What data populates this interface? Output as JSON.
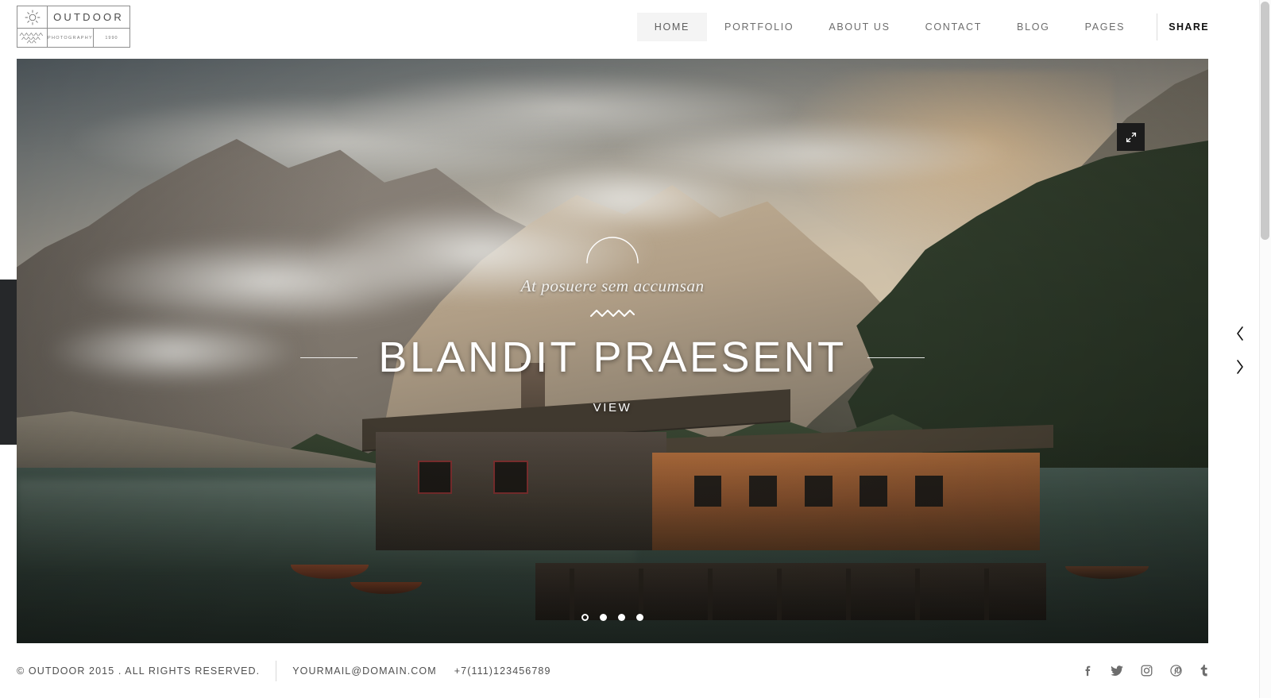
{
  "header": {
    "logo": {
      "name": "OUTDOOR",
      "subtitle": "PHOTOGRAPHY",
      "year": "1990",
      "sun_icon": "sun-icon",
      "mountain_icon": "mountain-pattern-icon"
    },
    "nav": [
      {
        "label": "HOME",
        "active": true
      },
      {
        "label": "PORTFOLIO",
        "active": false
      },
      {
        "label": "ABOUT US",
        "active": false
      },
      {
        "label": "CONTACT",
        "active": false
      },
      {
        "label": "BLOG",
        "active": false
      },
      {
        "label": "PAGES",
        "active": false
      }
    ],
    "share_label": "SHARE"
  },
  "hero": {
    "subtitle": "At posuere sem accumsan",
    "title": "BLANDIT PRAESENT",
    "view_label": "VIEW",
    "expand_icon": "expand-arrows-icon",
    "arc_icon": "arc-ornament-icon",
    "zigzag_icon": "zigzag-divider-icon",
    "dots": [
      {
        "state": "hollow"
      },
      {
        "state": "filled"
      },
      {
        "state": "filled"
      },
      {
        "state": "filled"
      }
    ],
    "prev_icon": "chevron-left-icon",
    "next_icon": "chevron-right-icon",
    "left_tab": "sidebar-toggle-tab"
  },
  "footer": {
    "copyright": "© OUTDOOR 2015 . ALL RIGHTS RESERVED.",
    "email": "YOURMAIL@DOMAIN.COM",
    "phone": "+7(111)123456789",
    "socials": [
      {
        "name": "facebook-icon"
      },
      {
        "name": "twitter-icon"
      },
      {
        "name": "instagram-icon"
      },
      {
        "name": "pinterest-icon"
      },
      {
        "name": "tumblr-icon"
      }
    ]
  },
  "colors": {
    "accent": "#1c1c1c",
    "nav_active_bg": "#f4f4f4",
    "text": "#4f4f4f",
    "hero_text": "#ffffff"
  }
}
